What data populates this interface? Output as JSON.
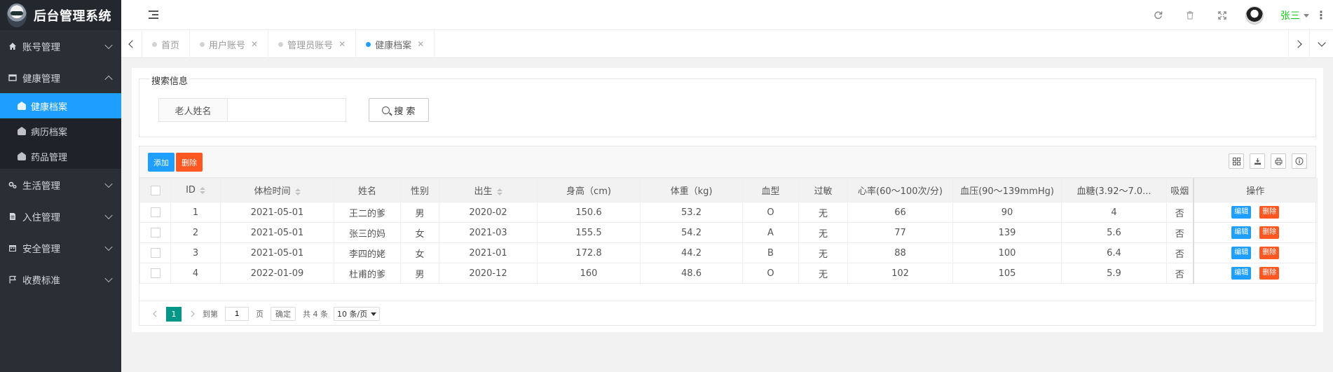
{
  "app": {
    "title": "后台管理系统"
  },
  "sidebar": {
    "items": [
      {
        "label": "账号管理",
        "icon": "home-icon",
        "expanded": false
      },
      {
        "label": "健康管理",
        "icon": "window-icon",
        "expanded": true,
        "children": [
          {
            "label": "健康档案",
            "icon": "dashboard-icon",
            "active": true
          },
          {
            "label": "病历档案",
            "icon": "dashboard-icon",
            "active": false
          },
          {
            "label": "药品管理",
            "icon": "dashboard-icon",
            "active": false
          }
        ]
      },
      {
        "label": "生活管理",
        "icon": "gears-icon",
        "expanded": false
      },
      {
        "label": "入住管理",
        "icon": "file-icon",
        "expanded": false
      },
      {
        "label": "安全管理",
        "icon": "calendar-icon",
        "expanded": false
      },
      {
        "label": "收费标准",
        "icon": "flag-icon",
        "expanded": false
      }
    ]
  },
  "header": {
    "user_name": "张三",
    "icons": [
      "refresh-icon",
      "trash-icon",
      "fullscreen-icon",
      "avatar",
      "more-icon"
    ]
  },
  "tabs": [
    {
      "label": "首页",
      "closable": false,
      "active": false
    },
    {
      "label": "用户账号",
      "closable": true,
      "active": false
    },
    {
      "label": "管理员账号",
      "closable": true,
      "active": false
    },
    {
      "label": "健康档案",
      "closable": true,
      "active": true
    }
  ],
  "search": {
    "legend": "搜索信息",
    "field_label": "老人姓名",
    "field_value": "",
    "button_label": "搜 索"
  },
  "toolbar": {
    "add_label": "添加",
    "delete_label": "删除"
  },
  "table": {
    "columns": [
      "ID",
      "体检时间",
      "姓名",
      "性别",
      "出生",
      "身高（cm)",
      "体重（kg)",
      "血型",
      "过敏",
      "心率(60～100次/分)",
      "血压(90～139mmHg)",
      "血糖(3.92～7.0...",
      "吸烟",
      "操作"
    ],
    "rows": [
      [
        "1",
        "2021-05-01",
        "王二的爹",
        "男",
        "2020-02",
        "150.6",
        "53.2",
        "O",
        "无",
        "66",
        "90",
        "4",
        "否"
      ],
      [
        "2",
        "2021-05-01",
        "张三的妈",
        "女",
        "2021-03",
        "155.5",
        "54.2",
        "A",
        "无",
        "77",
        "139",
        "5.6",
        "否"
      ],
      [
        "3",
        "2021-05-01",
        "李四的姥",
        "女",
        "2021-01",
        "172.8",
        "44.2",
        "B",
        "无",
        "88",
        "100",
        "6.4",
        "否"
      ],
      [
        "4",
        "2022-01-09",
        "杜甫的爹",
        "男",
        "2020-12",
        "160",
        "48.6",
        "O",
        "无",
        "102",
        "105",
        "5.9",
        "否"
      ]
    ],
    "row_actions": {
      "edit": "编辑",
      "delete": "删除"
    }
  },
  "pager": {
    "current": "1",
    "goto_prefix": "到第",
    "goto_value": "1",
    "goto_suffix": "页",
    "confirm": "确定",
    "total": "共 4 条",
    "page_size": "10 条/页"
  },
  "colors": {
    "sidebar_bg": "#2a2f36",
    "active_blue": "#1e9fff",
    "danger": "#ff5722",
    "pager_green": "#009688",
    "user_green": "#18c51d"
  }
}
